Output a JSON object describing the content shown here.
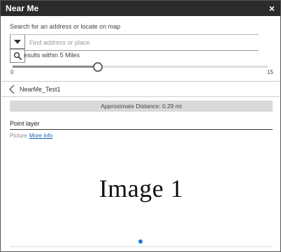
{
  "window": {
    "title": "Near Me",
    "close_symbol": "×"
  },
  "search": {
    "label": "Search for an address or locate on map",
    "placeholder": "Find address or place",
    "value": ""
  },
  "radius": {
    "results_text": "esults within 5 Miles",
    "min_label": "0",
    "max_label": "15",
    "value": 5,
    "min": 0,
    "max": 15
  },
  "nav": {
    "back_label": "NearMe_Test1"
  },
  "result": {
    "distance_text": "Approximate Distance: 0.29 mi"
  },
  "layer": {
    "title": "Point layer",
    "picture_label": "Picture",
    "more_info_label": "More info",
    "image_caption": "Image 1"
  },
  "colors": {
    "titlebar": "#2b2b2b",
    "accent": "#1a73e8",
    "link": "#1a5fb4"
  },
  "icons": {
    "dropdown": "caret-down-icon",
    "search": "magnifier-icon",
    "back": "chevron-left-icon"
  }
}
